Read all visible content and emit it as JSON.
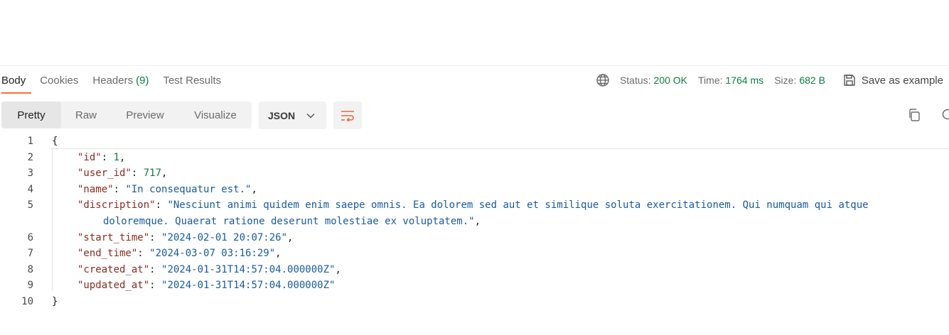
{
  "response_tabs": {
    "body": "Body",
    "cookies": "Cookies",
    "headers": "Headers",
    "headers_count": "(9)",
    "test_results": "Test Results"
  },
  "status_bar": {
    "status_label": "Status:",
    "status_value": "200 OK",
    "time_label": "Time:",
    "time_value": "1764 ms",
    "size_label": "Size:",
    "size_value": "682 B",
    "save_label": "Save as example"
  },
  "view_modes": [
    "Pretty",
    "Raw",
    "Preview",
    "Visualize"
  ],
  "format": {
    "selected": "JSON"
  },
  "icons": [
    "globe-icon",
    "save-icon",
    "chevron-down-icon",
    "wrap-lines-icon",
    "copy-icon",
    "search-icon"
  ],
  "colors": {
    "accent": "#ff6c37",
    "success": "#0c7d45",
    "json_key": "#8b2b1d",
    "json_string": "#1a5aa0"
  },
  "code": {
    "line_numbers": [
      "1",
      "2",
      "3",
      "4",
      "5",
      "6",
      "7",
      "8",
      "9",
      "10"
    ],
    "open_brace": "{",
    "close_brace": "}",
    "fields": [
      {
        "key": "\"id\"",
        "value": "1",
        "type": "number",
        "comma": ","
      },
      {
        "key": "\"user_id\"",
        "value": "717",
        "type": "number",
        "comma": ","
      },
      {
        "key": "\"name\"",
        "value": "\"In consequatur est.\"",
        "type": "string",
        "comma": ","
      },
      {
        "key": "\"discription\"",
        "value": "\"Nesciunt animi quidem enim saepe omnis. Ea dolorem sed aut et similique soluta exercitationem. Qui numquam qui atque",
        "value_cont": "doloremque. Quaerat ratione deserunt molestiae ex voluptatem.\"",
        "type": "string",
        "comma": ","
      },
      {
        "key": "\"start_time\"",
        "value": "\"2024-02-01 20:07:26\"",
        "type": "string",
        "comma": ","
      },
      {
        "key": "\"end_time\"",
        "value": "\"2024-03-07 03:16:29\"",
        "type": "string",
        "comma": ","
      },
      {
        "key": "\"created_at\"",
        "value": "\"2024-01-31T14:57:04.000000Z\"",
        "type": "string",
        "comma": ","
      },
      {
        "key": "\"updated_at\"",
        "value": "\"2024-01-31T14:57:04.000000Z\"",
        "type": "string",
        "comma": ""
      }
    ]
  }
}
